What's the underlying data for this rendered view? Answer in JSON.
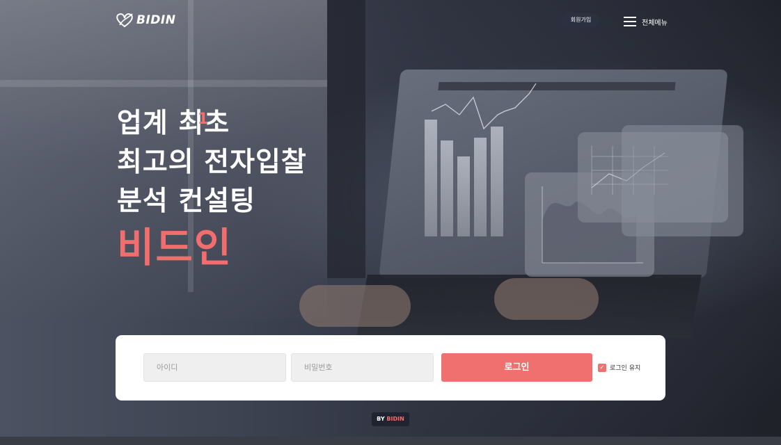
{
  "header": {
    "logo_text": "BIDIN",
    "signup_label": "회원가입",
    "menu_label": "전체메뉴"
  },
  "hero": {
    "line1": "업계 최초",
    "line1_accent": "1",
    "line2": "최고의 전자입찰",
    "line3": "분석 컨설팅",
    "brand": "비드인"
  },
  "login": {
    "id_placeholder": "아이디",
    "pw_placeholder": "비밀번호",
    "submit_label": "로그인",
    "remember_label": "로그인 유지",
    "remember_checked": true
  },
  "footer": {
    "by_label": "BY",
    "brand": "BIDIN"
  },
  "colors": {
    "accent": "#f26d6d",
    "button": "#f07070",
    "dark_badge": "#1f2430"
  }
}
